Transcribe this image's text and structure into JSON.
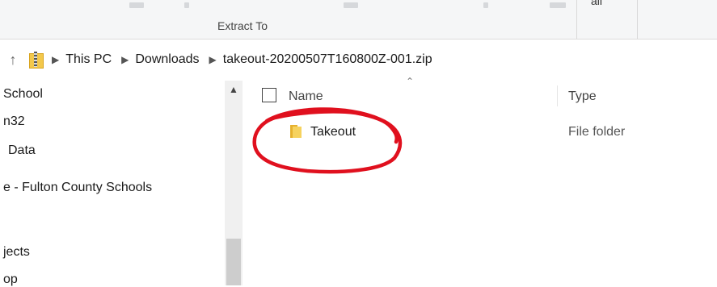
{
  "ribbon": {
    "group_label": "Extract To",
    "truncated_label": "all"
  },
  "address": {
    "crumbs": [
      "This PC",
      "Downloads",
      "takeout-20200507T160800Z-001.zip"
    ]
  },
  "nav": {
    "items": [
      "School",
      "n32",
      "Data",
      "e - Fulton County Schools",
      "jects",
      "op"
    ]
  },
  "list": {
    "columns": {
      "name": "Name",
      "type": "Type"
    },
    "rows": [
      {
        "name": "Takeout",
        "type": "File folder"
      }
    ]
  },
  "colors": {
    "annotation": "#e0101e",
    "folder": "#f6d25e"
  }
}
